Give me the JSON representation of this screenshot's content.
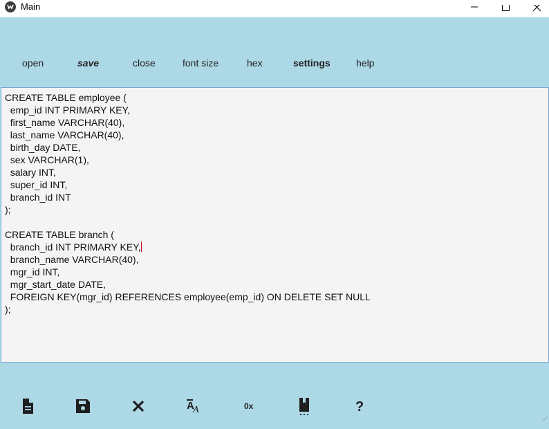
{
  "window": {
    "title": "Main"
  },
  "menu": {
    "open": "open",
    "save": "save",
    "close": "close",
    "font_size": "font size",
    "hex": "hex",
    "settings": "settings",
    "help": "help"
  },
  "editor": {
    "lines": [
      "CREATE TABLE employee (",
      "  emp_id INT PRIMARY KEY,",
      "  first_name VARCHAR(40),",
      "  last_name VARCHAR(40),",
      "  birth_day DATE,",
      "  sex VARCHAR(1),",
      "  salary INT,",
      "  super_id INT,",
      "  branch_id INT",
      ");",
      "",
      "CREATE TABLE branch (",
      "  branch_id INT PRIMARY KEY,",
      "  branch_name VARCHAR(40),",
      "  mgr_id INT,",
      "  mgr_start_date DATE,",
      "  FOREIGN KEY(mgr_id) REFERENCES employee(emp_id) ON DELETE SET NULL",
      ");"
    ],
    "caret_line": 12
  },
  "toolbar": {
    "icons": [
      "file-icon",
      "save-icon",
      "close-icon",
      "font-size-icon",
      "hex-icon",
      "bookmark-icon",
      "help-icon"
    ],
    "hex_label": "0x",
    "help_label": "?"
  },
  "colors": {
    "background": "#ADD8E6",
    "editor_bg": "#f4f4f4",
    "editor_border": "#7aa7d6",
    "caret": "#d0021b"
  }
}
